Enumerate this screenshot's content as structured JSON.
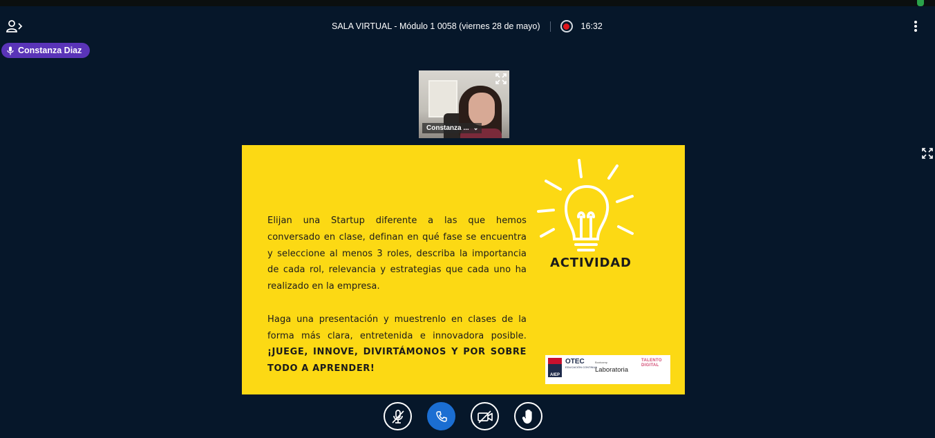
{
  "header": {
    "title": "SALA VIRTUAL - Módulo 1 0058 (viernes 28 de mayo)",
    "recording_time": "16:32",
    "icons": [
      "users-toggle-icon",
      "record-icon",
      "more-options-icon"
    ]
  },
  "talking_indicator": {
    "name": "Constanza Diaz",
    "icon": "microphone-icon"
  },
  "webcam": {
    "label": "Constanza ...",
    "icons": [
      "expand-icon",
      "chevron-down-icon"
    ]
  },
  "presentation": {
    "paragraph1": "Elijan una Startup diferente a las que hemos conversado en clase, definan en qué fase se encuentra y seleccione al menos 3 roles, describa la importancia de cada rol, relevancia y estrategias que cada uno ha realizado en la empresa.",
    "paragraph2": "Haga una presentación y muestrenlo en clases de la forma más clara, entretenida e innovadora posible.",
    "callout": "¡JUEGE, INNOVE, DIVIRTÁMONOS Y POR SOBRE TODO A APRENDER!",
    "heading": "ACTIVIDAD",
    "logos": {
      "aiep": "AIEP",
      "otec": "OTEC",
      "otec_sub": "EDUCACIÓN CONTINUA",
      "laboratoria": "Laboratoria",
      "laboratoria_sub": "Bootcamp",
      "talento": "TALENTO DIGITAL"
    }
  },
  "controls": [
    {
      "name": "mute-button",
      "icon": "microphone-off-icon"
    },
    {
      "name": "leave-audio-button",
      "icon": "phone-icon"
    },
    {
      "name": "share-webcam-button",
      "icon": "video-off-icon"
    },
    {
      "name": "raise-hand-button",
      "icon": "hand-icon"
    }
  ],
  "colors": {
    "background": "#06172a",
    "talker_badge": "#5a34b8",
    "slide": "#fcd914",
    "record_dot": "#e0151b",
    "call_button": "#1b6ed2"
  }
}
